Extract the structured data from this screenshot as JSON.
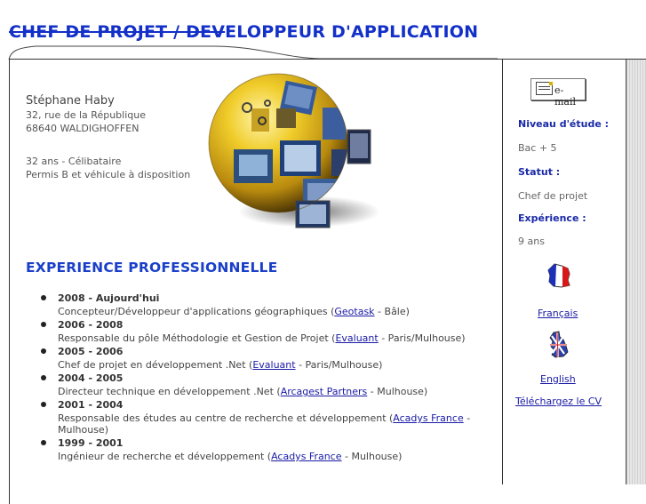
{
  "header": {
    "title_struck": "CHEF DE PROJET / DEV",
    "title_rest": "ELOPPEUR D'APPLICATION"
  },
  "contact": {
    "name": "Stéphane Haby",
    "address_line1": "32, rue de la République",
    "address_line2": "68640 WALDIGHOFFEN",
    "age_status": "32 ans - Célibataire",
    "license": "Permis B et véhicule à disposition"
  },
  "experience": {
    "title": "EXPERIENCE PROFESSIONNELLE",
    "items": [
      {
        "period": "2008 - Aujourd'hui",
        "desc_pre": "Concepteur/Développeur d'applications géographiques (",
        "link": "Geotask",
        "desc_post": " - Bâle)"
      },
      {
        "period": "2006 - 2008",
        "desc_pre": "Responsable du pôle Méthodologie et Gestion de Projet (",
        "link": "Evaluant",
        "desc_post": " - Paris/Mulhouse)"
      },
      {
        "period": "2005 - 2006",
        "desc_pre": "Chef de projet en développement .Net (",
        "link": "Evaluant",
        "desc_post": " - Paris/Mulhouse)"
      },
      {
        "period": "2004 - 2005",
        "desc_pre": "Directeur technique en développement .Net (",
        "link": "Arcagest Partners",
        "desc_post": " - Mulhouse)"
      },
      {
        "period": "2001 - 2004",
        "desc_pre": "Responsable des études au centre de recherche et développement (",
        "link": "Acadys France",
        "desc_post": " - Mulhouse)"
      },
      {
        "period": "1999 - 2001",
        "desc_pre": "Ingénieur de recherche et développement (",
        "link": "Acadys France",
        "desc_post": " - Mulhouse)"
      }
    ]
  },
  "sidebar": {
    "email_label": "e-mail",
    "niveau_label": "Niveau d'étude :",
    "niveau_value": "Bac + 5",
    "statut_label": "Statut :",
    "statut_value": "Chef de projet",
    "experience_label": "Expérience :",
    "experience_value": "9 ans",
    "lang_fr": "Français",
    "lang_en": "English",
    "download_cv": "Téléchargez le CV"
  },
  "icons": {
    "email": "envelope-icon",
    "flag_fr": "france-map-flag-icon",
    "flag_uk": "uk-map-flag-icon",
    "globe": "photo-globe-icon"
  },
  "colors": {
    "title_blue": "#1330c8",
    "heading_blue": "#1a3fc8",
    "link_blue": "#1a1aa6",
    "globe_yellow": "#e8c21c"
  }
}
